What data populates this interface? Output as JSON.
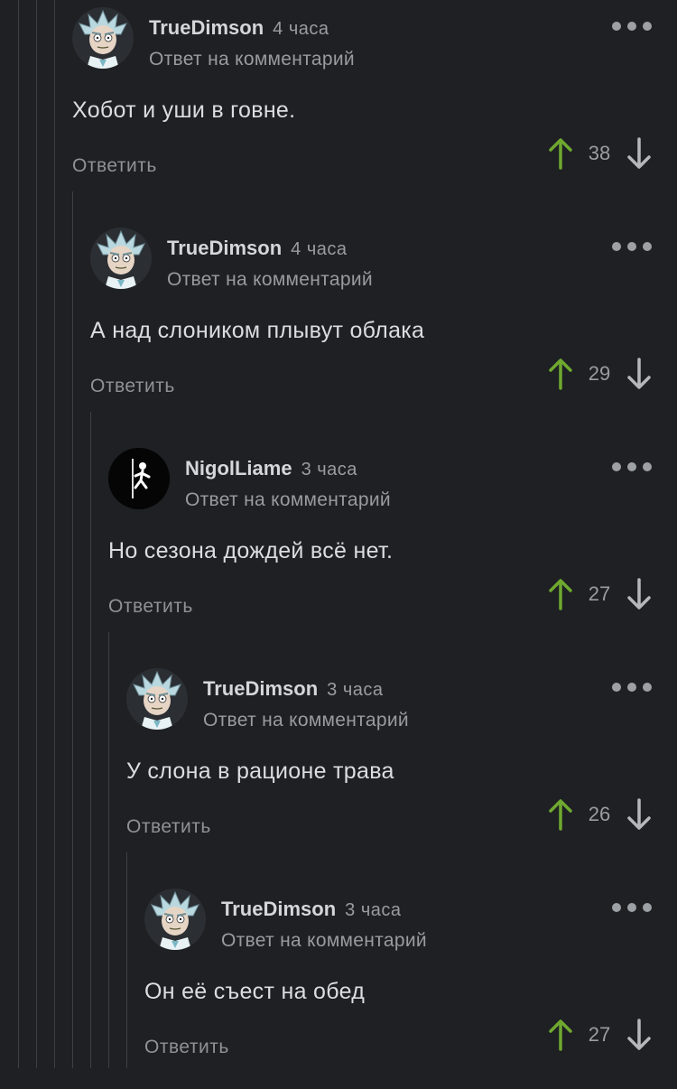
{
  "ui": {
    "reply_label": "Ответ на комментарий",
    "reply_button": "Ответить",
    "upvote_color": "#6fa82f",
    "downvote_color": "#b5b7ba"
  },
  "comments": [
    {
      "author": "TrueDimson",
      "time": "4 часа",
      "text": "Хобот и уши в говне.",
      "rating": "38",
      "avatar": "rick-avatar"
    },
    {
      "author": "TrueDimson",
      "time": "4 часа",
      "text": "А над слоником плывут облака",
      "rating": "29",
      "avatar": "rick-avatar"
    },
    {
      "author": "NigolLiame",
      "time": "3 часа",
      "text": "Но сезона дождей всё нет.",
      "rating": "27",
      "avatar": "portal-stickman-avatar"
    },
    {
      "author": "TrueDimson",
      "time": "3 часа",
      "text": "У слона в рационе трава",
      "rating": "26",
      "avatar": "rick-avatar"
    },
    {
      "author": "TrueDimson",
      "time": "3 часа",
      "text": "Он её съест на обед",
      "rating": "27",
      "avatar": "rick-avatar"
    }
  ]
}
